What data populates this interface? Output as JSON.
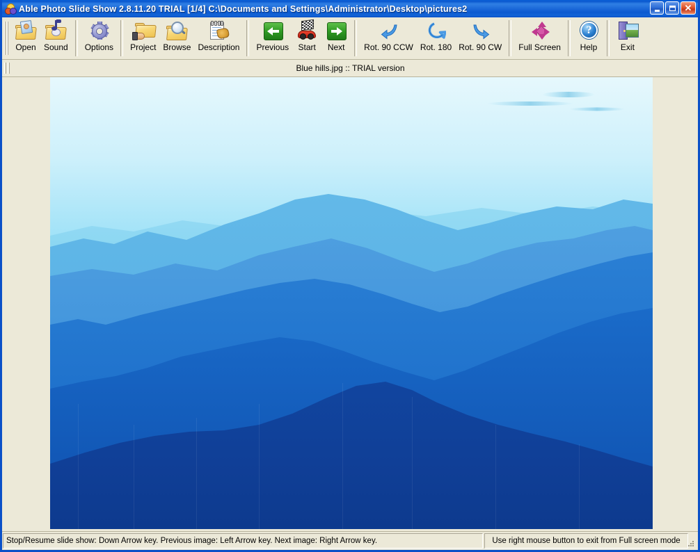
{
  "window": {
    "title": "Able Photo Slide Show 2.8.11.20 TRIAL  [1/4] C:\\Documents and Settings\\Administrator\\Desktop\\pictures2",
    "app_icon": "photo-balls-icon",
    "controls": {
      "minimize": "_",
      "maximize": "□",
      "close": "✕"
    },
    "colors": {
      "title_gradient_start": "#0a62d8",
      "title_gradient_end": "#0a50c8",
      "face": "#ece9d8",
      "border": "#0a50c8"
    }
  },
  "toolbar": {
    "groups": [
      {
        "name": "file",
        "buttons": [
          {
            "label": "Open",
            "icon": "open-folder-photo-icon"
          },
          {
            "label": "Sound",
            "icon": "folder-music-note-icon"
          }
        ]
      },
      {
        "name": "settings",
        "buttons": [
          {
            "label": "Options",
            "icon": "gear-icon"
          }
        ]
      },
      {
        "name": "content",
        "buttons": [
          {
            "label": "Project",
            "icon": "hand-folder-icon"
          },
          {
            "label": "Browse",
            "icon": "folder-magnifier-icon"
          },
          {
            "label": "Description",
            "icon": "notepad-pencil-icon"
          }
        ]
      },
      {
        "name": "navigation",
        "buttons": [
          {
            "label": "Previous",
            "icon": "arrow-left-green-icon"
          },
          {
            "label": "Start",
            "icon": "checkered-flag-car-icon"
          },
          {
            "label": "Next",
            "icon": "arrow-right-green-icon"
          }
        ]
      },
      {
        "name": "rotation",
        "buttons": [
          {
            "label": "Rot. 90 CCW",
            "icon": "rotate-ccw-arrow-icon"
          },
          {
            "label": "Rot. 180",
            "icon": "rotate-180-arrow-icon"
          },
          {
            "label": "Rot. 90 CW",
            "icon": "rotate-cw-arrow-icon"
          }
        ]
      },
      {
        "name": "view",
        "buttons": [
          {
            "label": "Full Screen",
            "icon": "four-way-arrows-icon"
          }
        ]
      },
      {
        "name": "help",
        "buttons": [
          {
            "label": "Help",
            "icon": "question-mark-icon"
          }
        ]
      },
      {
        "name": "exit",
        "buttons": [
          {
            "label": "Exit",
            "icon": "door-exit-icon"
          }
        ]
      }
    ]
  },
  "infobar": {
    "text": "Blue hills.jpg :: TRIAL version"
  },
  "viewer": {
    "image_name": "Blue hills.jpg",
    "alt": "Blue hills photograph: layered blue mountain ridges under a pale blue sky"
  },
  "statusbar": {
    "left": "Stop/Resume slide show: Down Arrow key. Previous image: Left Arrow key. Next image: Right Arrow key.",
    "right": "Use right mouse button to exit from Full screen mode"
  }
}
